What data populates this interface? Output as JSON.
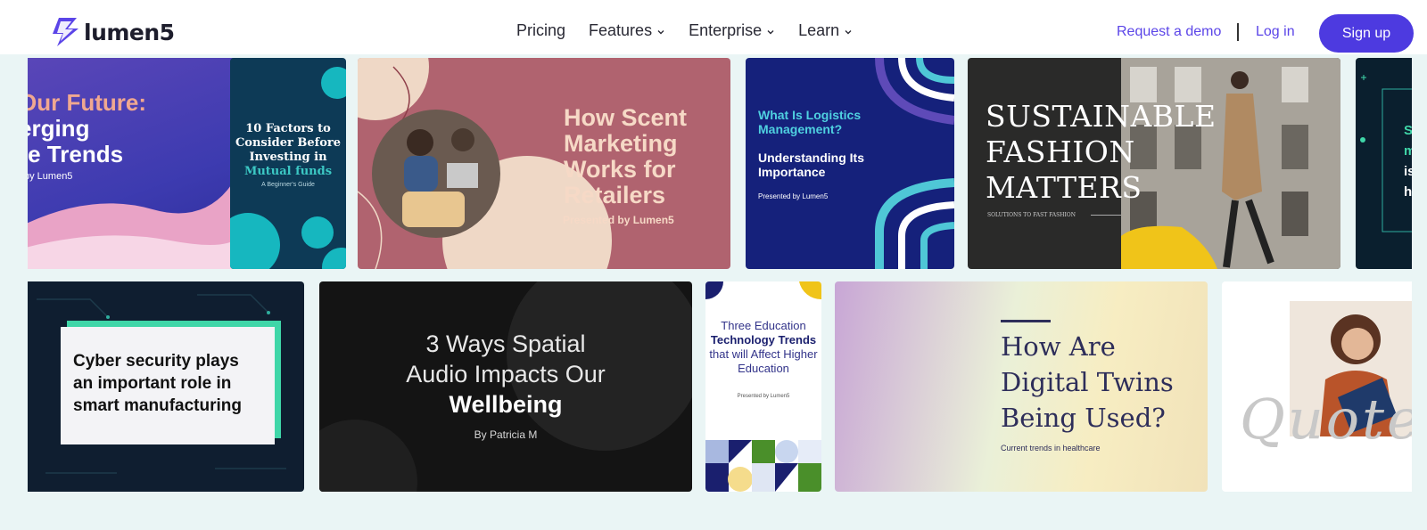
{
  "brand": {
    "name": "lumen5",
    "accent": "#4d3ae0",
    "link_color": "#5b45e8"
  },
  "nav": {
    "menu": [
      {
        "label": "Pricing",
        "has_dropdown": false
      },
      {
        "label": "Features",
        "has_dropdown": true
      },
      {
        "label": "Enterprise",
        "has_dropdown": true
      },
      {
        "label": "Learn",
        "has_dropdown": true
      }
    ],
    "request_demo": "Request a demo",
    "login": "Log in",
    "signup": "Sign up"
  },
  "gallery": {
    "row1": [
      {
        "line1": "Our Future:",
        "line2": "erging",
        "line3": "re Trends",
        "byline": "by Lumen5"
      },
      {
        "title_a": "10 Factors to Consider Before Investing in",
        "title_b": "Mutual funds",
        "subtitle": "A Beginner's Guide"
      },
      {
        "title": "How Scent Marketing Works for Retailers",
        "byline": "Presented by Lumen5"
      },
      {
        "title_a": "What Is Logistics Management?",
        "title_b": "Understanding Its Importance",
        "byline": "Presented by Lumen5"
      },
      {
        "title": "SUSTAINABLE FASHION MATTERS",
        "subtitle": "SOLUTIONS TO FAST FASHION"
      },
      {
        "line1": "S",
        "line2": "m",
        "line3": "is",
        "line4": "h"
      }
    ],
    "row2": [
      {
        "title": "Cyber security plays an important role in smart manufacturing"
      },
      {
        "title_a": "3 Ways Spatial Audio Impacts Our",
        "title_b": "Wellbeing",
        "byline": "By Patricia M"
      },
      {
        "title_a": "Three Education",
        "title_b": "Technology Trends",
        "title_c": "that will Affect Higher Education",
        "byline": "Presented by Lumen5"
      },
      {
        "title": "How Are Digital Twins Being Used?",
        "subtitle": "Current trends in healthcare"
      },
      {
        "decor": "Quote"
      }
    ]
  }
}
